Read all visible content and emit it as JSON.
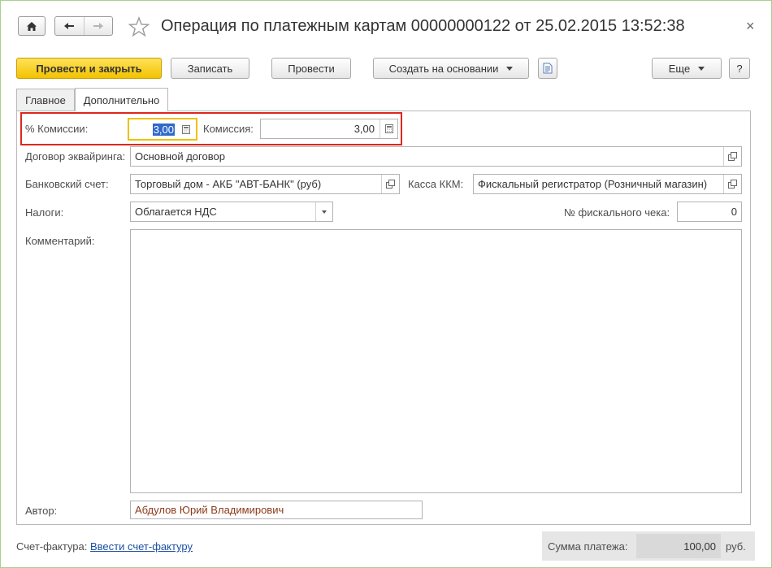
{
  "window": {
    "title": "Операция по платежным картам 00000000122 от 25.02.2015 13:52:38",
    "close_glyph": "×"
  },
  "toolbar": {
    "post_and_close": "Провести и закрыть",
    "save": "Записать",
    "post": "Провести",
    "create_based_on": "Создать на основании",
    "more": "Еще",
    "help": "?"
  },
  "tabs": [
    {
      "label": "Главное",
      "active": false
    },
    {
      "label": "Дополнительно",
      "active": true
    }
  ],
  "form": {
    "commission_percent": {
      "label": "% Комиссии:",
      "value": "3,00"
    },
    "commission": {
      "label": "Комиссия:",
      "value": "3,00"
    },
    "acquiring_contract": {
      "label": "Договор эквайринга:",
      "value": "Основной договор"
    },
    "bank_account": {
      "label": "Банковский счет:",
      "value": "Торговый дом - АКБ \"АВТ-БАНК\" (руб)"
    },
    "cash_register": {
      "label": "Касса ККМ:",
      "value": "Фискальный регистратор (Розничный магазин)"
    },
    "taxes": {
      "label": "Налоги:",
      "value": "Облагается НДС"
    },
    "fiscal_receipt": {
      "label": "№ фискального чека:",
      "value": "0"
    },
    "comment": {
      "label": "Комментарий:",
      "value": ""
    },
    "author": {
      "label": "Автор:",
      "value": "Абдулов Юрий Владимирович"
    }
  },
  "footer": {
    "invoice_label": "Счет-фактура:",
    "invoice_link": "Ввести счет-фактуру",
    "total_label": "Сумма платежа:",
    "total_value": "100,00",
    "currency": "руб."
  },
  "colors": {
    "primary_button": "#f2c200",
    "highlight_frame": "#e0261b",
    "focus_border": "#f0c000",
    "link": "#1a4fa3",
    "author_text": "#8b3a1a"
  }
}
